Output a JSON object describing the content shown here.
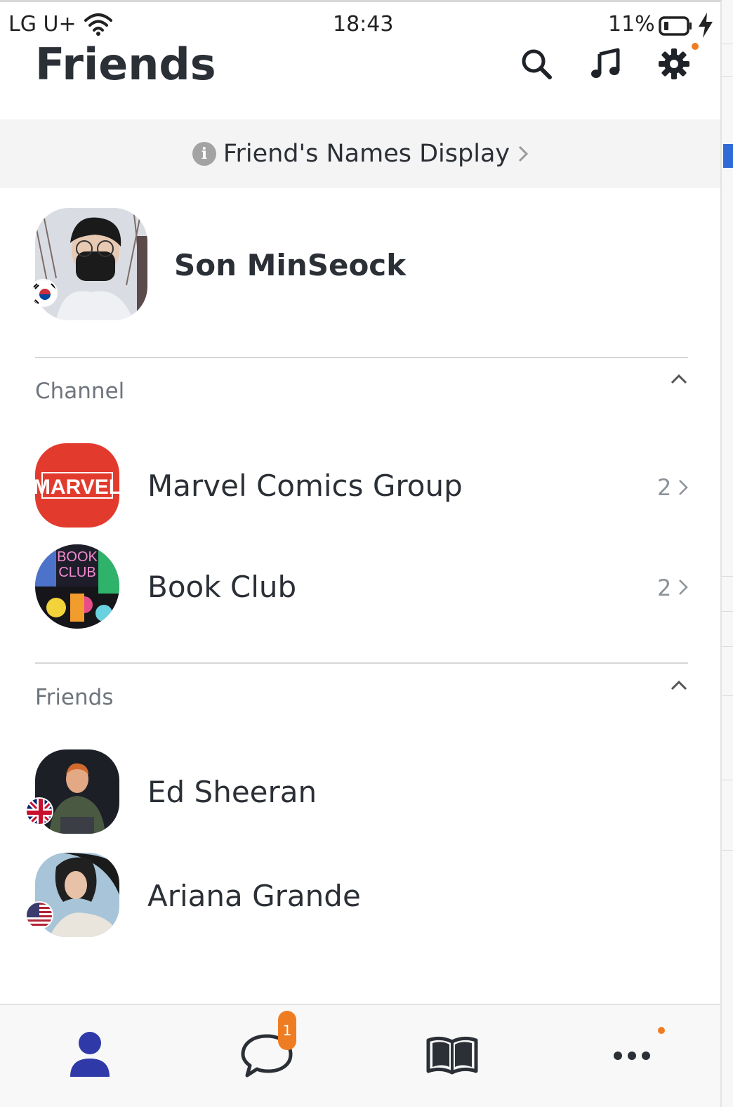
{
  "status_bar": {
    "carrier": "LG U+",
    "time": "18:43",
    "battery_percent": "11%"
  },
  "header": {
    "title": "Friends",
    "icons": [
      "search-icon",
      "music-note-icon",
      "gear-icon"
    ],
    "settings_has_dot": true
  },
  "banner": {
    "text": "Friend's Names Display"
  },
  "profile": {
    "name": "Son MinSeock",
    "flag": "south-korea-flag-icon"
  },
  "sections": {
    "channel_label": "Channel",
    "friends_label": "Friends"
  },
  "channels": [
    {
      "name": "Marvel Comics Group",
      "count": "2",
      "logo_text": "MARVEL"
    },
    {
      "name": "Book Club",
      "count": "2",
      "logo_text": "BOOK CLUB"
    }
  ],
  "friends": [
    {
      "name": "Ed Sheeran",
      "flag": "uk-flag-icon"
    },
    {
      "name": "Ariana Grande",
      "flag": "us-flag-icon"
    }
  ],
  "tabbar": {
    "tabs": [
      "friends-tab-icon",
      "chats-tab-icon",
      "open-book-icon",
      "more-icon"
    ],
    "chats_badge": "1",
    "more_has_dot": true
  },
  "colors": {
    "accent_orange": "#f07c22",
    "active_tab": "#2f3aa8",
    "marvel_red": "#e23b2e"
  }
}
